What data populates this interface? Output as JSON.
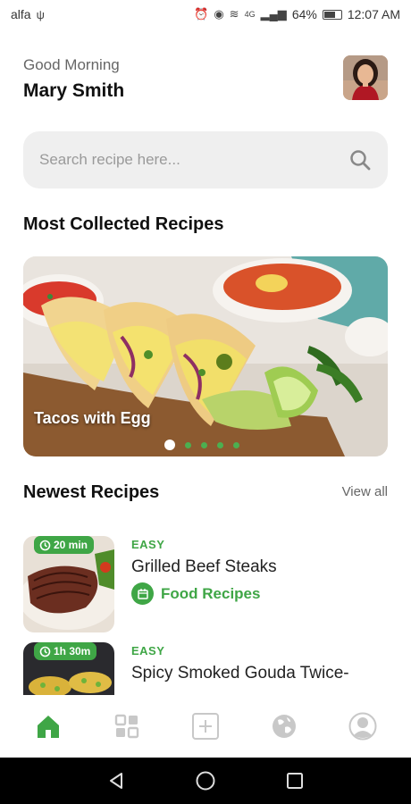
{
  "status_bar": {
    "carrier": "alfa",
    "network": "4G",
    "battery": "64%",
    "time": "12:07 AM"
  },
  "header": {
    "greeting": "Good Morning",
    "user_name": "Mary Smith"
  },
  "search": {
    "placeholder": "Search recipe here..."
  },
  "sections": {
    "collected_title": "Most Collected Recipes",
    "newest_title": "Newest Recipes",
    "view_all": "View all"
  },
  "carousel": {
    "slide_title": "Tacos with Egg",
    "slide_count": 5,
    "active_index": 0
  },
  "recipes": [
    {
      "time": "20 min",
      "level": "EASY",
      "title": "Grilled Beef Steaks",
      "category": "Food Recipes"
    },
    {
      "time": "1h 30m",
      "level": "EASY",
      "title": "Spicy Smoked Gouda Twice-"
    }
  ],
  "bottom_nav": {
    "items": [
      "home-icon",
      "categories-icon",
      "add-icon",
      "explore-icon",
      "profile-icon"
    ],
    "active": "home-icon"
  },
  "colors": {
    "accent": "#3fa646",
    "search_bg": "#efefef",
    "nav_inactive": "#c8c8c8"
  }
}
